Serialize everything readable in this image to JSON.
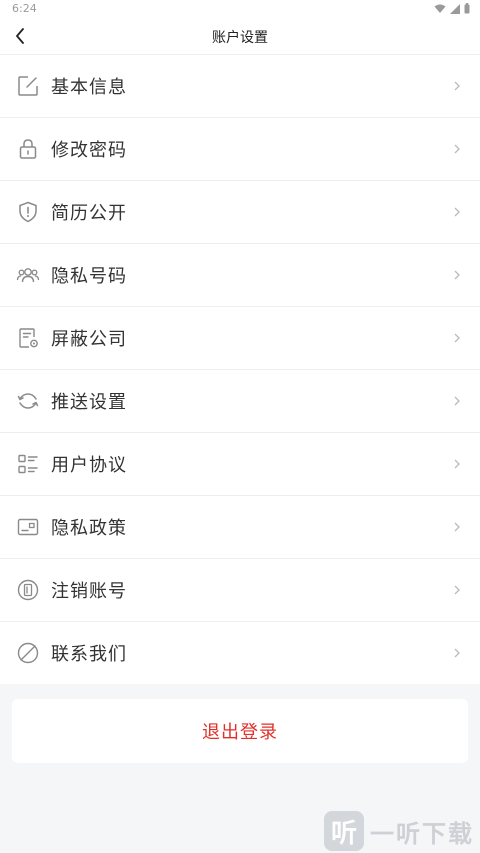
{
  "status_bar": {
    "time": "6:24"
  },
  "header": {
    "title": "账户设置"
  },
  "menu": {
    "items": [
      {
        "label": "基本信息",
        "icon": "edit-icon"
      },
      {
        "label": "修改密码",
        "icon": "lock-icon"
      },
      {
        "label": "简历公开",
        "icon": "shield-icon"
      },
      {
        "label": "隐私号码",
        "icon": "users-icon"
      },
      {
        "label": "屏蔽公司",
        "icon": "document-gear-icon"
      },
      {
        "label": "推送设置",
        "icon": "sync-icon"
      },
      {
        "label": "用户协议",
        "icon": "list-icon"
      },
      {
        "label": "隐私政策",
        "icon": "card-icon"
      },
      {
        "label": "注销账号",
        "icon": "phone-circle-icon"
      },
      {
        "label": "联系我们",
        "icon": "leaf-icon"
      }
    ]
  },
  "logout": {
    "label": "退出登录"
  },
  "watermark": {
    "text": "一听下载",
    "logo_char": "听"
  },
  "colors": {
    "accent": "#e0302b",
    "background": "#f5f6f8",
    "icon": "#8a8a8a"
  }
}
